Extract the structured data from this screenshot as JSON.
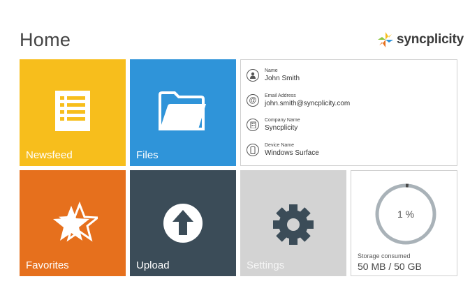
{
  "page": {
    "title": "Home"
  },
  "brand": {
    "name": "syncplicity"
  },
  "tiles": {
    "newsfeed": {
      "label": "Newsfeed",
      "icon": "list-icon",
      "color": "#F7BE1C"
    },
    "files": {
      "label": "Files",
      "icon": "folder-icon",
      "color": "#2F94D9"
    },
    "favorites": {
      "label": "Favorites",
      "icon": "stars-icon",
      "color": "#E6701D"
    },
    "upload": {
      "label": "Upload",
      "icon": "upload-arrow-icon",
      "color": "#3B4C58"
    },
    "settings": {
      "label": "Settings",
      "icon": "gear-icon",
      "color": "#D3D3D3"
    }
  },
  "account": {
    "name": {
      "label": "Name",
      "value": "John Smith",
      "icon": "person-icon"
    },
    "email": {
      "label": "Email Address",
      "value": "john.smith@syncplicity.com",
      "icon": "at-icon"
    },
    "company": {
      "label": "Company Name",
      "value": "Syncplicity",
      "icon": "building-icon"
    },
    "device": {
      "label": "Device Name",
      "value": "Windows Surface",
      "icon": "tablet-icon"
    }
  },
  "storage": {
    "percent_text": "1 %",
    "percent": 1,
    "label": "Storage consumed",
    "value": "50 MB / 50 GB"
  }
}
